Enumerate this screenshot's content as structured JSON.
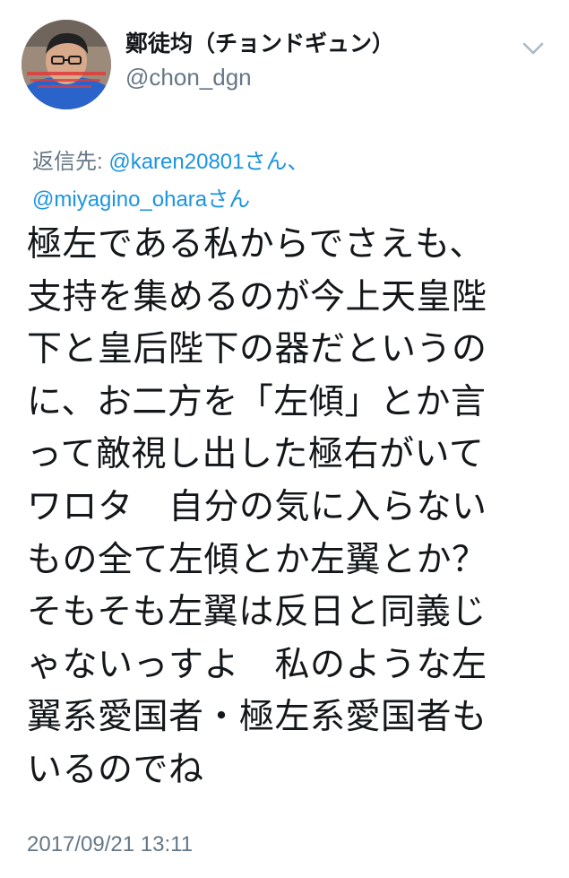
{
  "tweet": {
    "author": {
      "display_name": "鄭徒均（チョンドギュン）",
      "handle": "@chon_dgn"
    },
    "icons": {
      "menu": "chevron-down-icon",
      "avatar": "profile-photo"
    },
    "reply_to": {
      "prefix": "返信先: ",
      "user1": "@karen20801",
      "suffix1": "さん、",
      "user2": "@miyagino_ohara",
      "suffix2": "さん"
    },
    "text_lines": [
      "極左である私からでさえも、",
      "支持を集めるのが今上天皇陛",
      "下と皇后陛下の器だというの",
      "に、お二方を「左傾」とか言",
      "って敵視し出した極右がいて",
      "ワロタ　自分の気に入らない",
      "もの全て左傾とか左翼とか？",
      "そもそも左翼は反日と同義じ",
      "ゃないっすよ　私のような左",
      "翼系愛国者・極左系愛国者も",
      "いるのでね"
    ],
    "timestamp": "2017/09/21 13:11"
  },
  "colors": {
    "text": "#14171a",
    "secondary": "#657786",
    "link": "#1b95e0"
  }
}
